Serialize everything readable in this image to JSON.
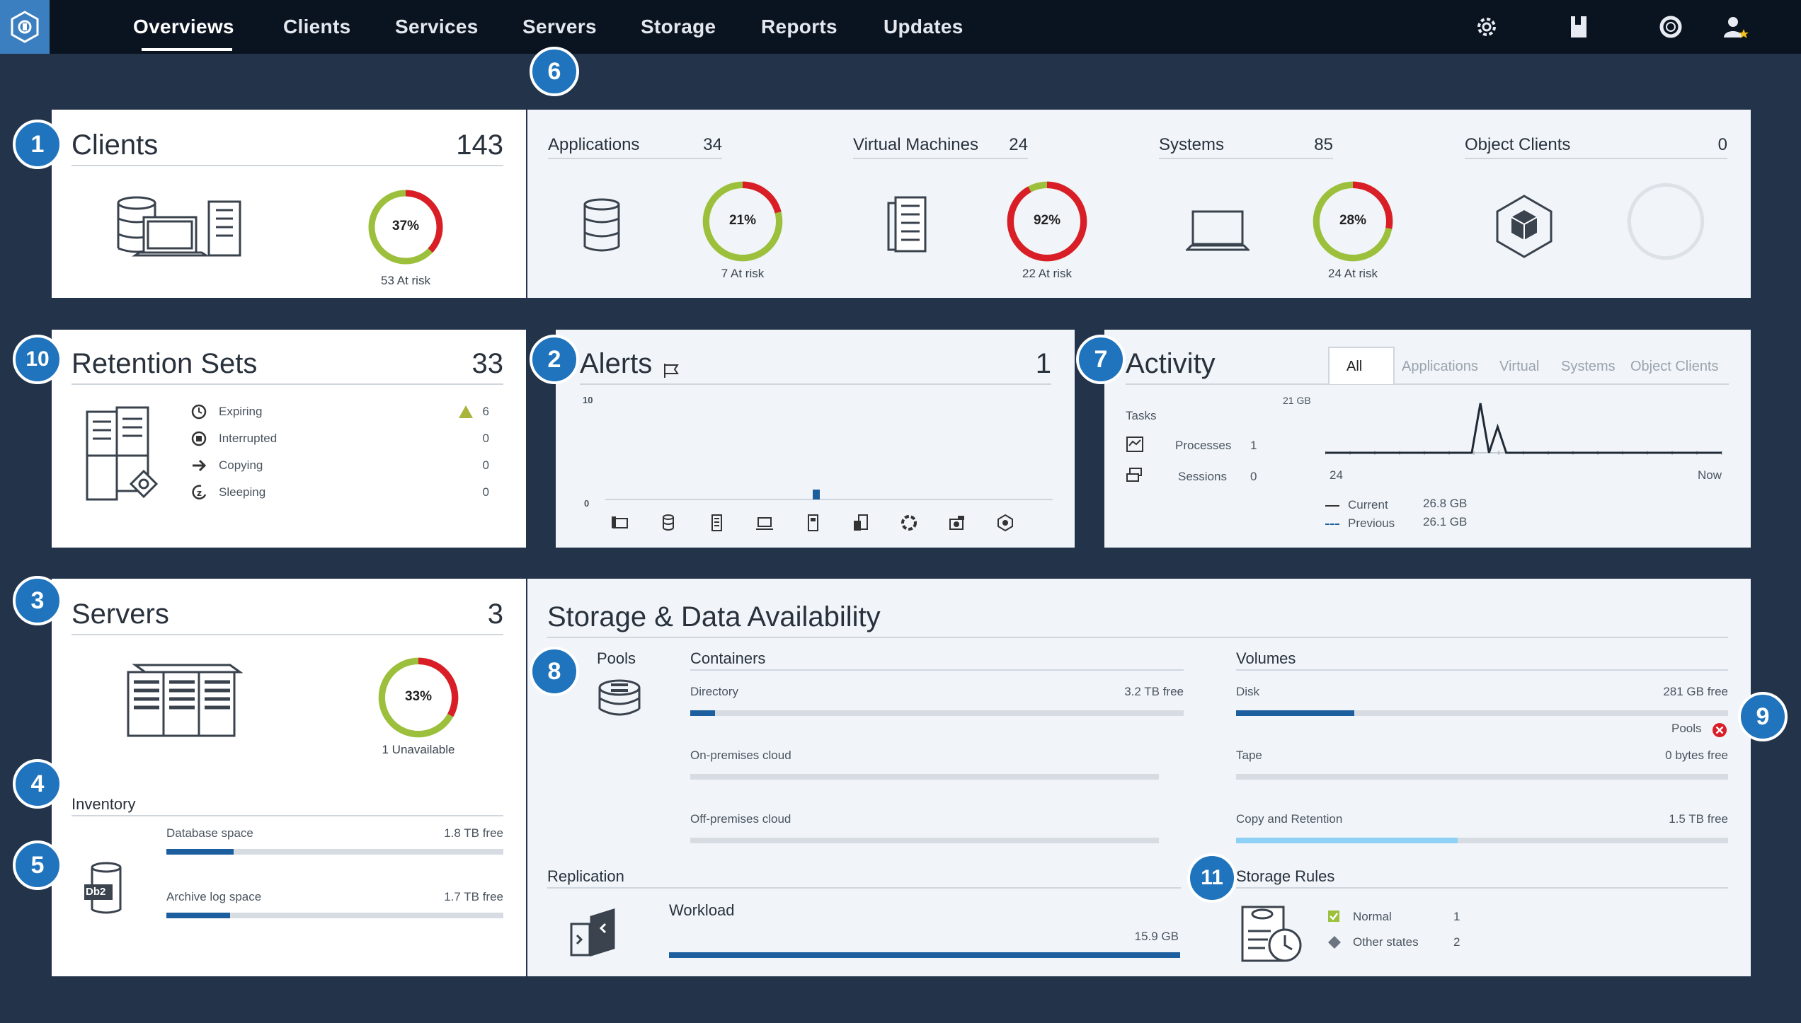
{
  "nav": {
    "items": [
      "Overviews",
      "Clients",
      "Services",
      "Servers",
      "Storage",
      "Reports",
      "Updates"
    ]
  },
  "colors": {
    "accent": "#1f74bd",
    "ok": "#9cc03b",
    "risk": "#da1e28",
    "bar": "#1d5f9e",
    "bar_light": "#8fd0f5"
  },
  "badges": [
    "1",
    "2",
    "3",
    "4",
    "5",
    "6",
    "7",
    "8",
    "9",
    "10",
    "11"
  ],
  "clients": {
    "title": "Clients",
    "count": "143",
    "ring_label": "37%",
    "ring_pct": 37,
    "risk_text": "53 At risk",
    "applications": {
      "title": "Applications",
      "count": "34",
      "ring_label": "21%",
      "ring_pct": 21,
      "risk_text": "7 At risk"
    },
    "virtual_machines": {
      "title": "Virtual Machines",
      "count": "24",
      "ring_label": "92%",
      "ring_pct": 92,
      "risk_text": "22 At risk"
    },
    "systems": {
      "title": "Systems",
      "count": "85",
      "ring_label": "28%",
      "ring_pct": 28,
      "risk_text": "24 At risk"
    },
    "object_clients": {
      "title": "Object Clients",
      "count": "0"
    }
  },
  "retention": {
    "title": "Retention Sets",
    "count": "33",
    "rows": [
      {
        "label": "Expiring",
        "value": "6"
      },
      {
        "label": "Interrupted",
        "value": "0"
      },
      {
        "label": "Copying",
        "value": "0"
      },
      {
        "label": "Sleeping",
        "value": "0"
      }
    ]
  },
  "alerts": {
    "title": "Alerts",
    "count": "1",
    "y_max": "10",
    "y_min": "0",
    "chart_data": {
      "type": "bar",
      "categories": [
        "c1",
        "c2",
        "c3",
        "c4",
        "c5",
        "c6",
        "c7",
        "c8",
        "c9"
      ],
      "values": [
        0,
        0,
        0,
        0,
        1,
        0,
        0,
        0,
        0
      ],
      "ylim": [
        0,
        10
      ]
    }
  },
  "activity": {
    "title": "Activity",
    "tabs": [
      "All",
      "Applications",
      "Virtual",
      "Systems",
      "Object Clients"
    ],
    "tasks_label": "Tasks",
    "processes_label": "Processes",
    "processes_value": "1",
    "sessions_label": "Sessions",
    "sessions_value": "0",
    "y_label": "21 GB",
    "x_start": "24",
    "x_end": "Now",
    "current_label": "Current",
    "current_value": "26.8 GB",
    "previous_label": "Previous",
    "previous_value": "26.1 GB",
    "chart_data": {
      "type": "line",
      "series": [
        {
          "values": [
            0,
            0,
            0,
            0,
            0,
            0,
            0,
            0,
            0,
            0,
            0,
            0,
            0,
            0,
            0,
            0,
            0,
            0,
            21,
            0,
            11,
            0,
            0,
            0,
            0,
            0,
            0,
            0,
            0,
            0,
            0,
            0,
            0,
            0,
            0,
            0,
            0,
            0,
            0,
            0,
            0,
            0,
            0,
            0,
            0,
            0,
            0
          ]
        }
      ],
      "ylim": [
        0,
        21
      ]
    }
  },
  "servers": {
    "title": "Servers",
    "count": "3",
    "ring_label": "33%",
    "ring_pct": 33,
    "unavailable_text": "1 Unavailable",
    "inventory_label": "Inventory",
    "db2_label": "Db2",
    "database_label": "Database space",
    "database_free": "1.8 TB free",
    "database_pct": 0.2,
    "archive_label": "Archive log space",
    "archive_free": "1.7 TB free",
    "archive_pct": 0.19
  },
  "storage": {
    "title": "Storage & Data Availability",
    "pools_label": "Pools",
    "containers_label": "Containers",
    "directory_label": "Directory",
    "directory_free": "3.2 TB free",
    "directory_pct": 0.05,
    "onprem_label": "On-premises cloud",
    "offprem_label": "Off-premises cloud",
    "volumes_label": "Volumes",
    "disk_label": "Disk",
    "disk_free": "281 GB free",
    "disk_pct": 0.24,
    "pools_status_label": "Pools",
    "tape_label": "Tape",
    "tape_free": "0 bytes free",
    "copy_label": "Copy and Retention",
    "copy_free": "1.5 TB free",
    "copy_pct": 0.45,
    "replication_label": "Replication",
    "workload_label": "Workload",
    "workload_value": "15.9 GB",
    "workload_pct": 1.0,
    "rules_label": "Storage Rules",
    "normal_label": "Normal",
    "normal_value": "1",
    "other_label": "Other states",
    "other_value": "2"
  }
}
